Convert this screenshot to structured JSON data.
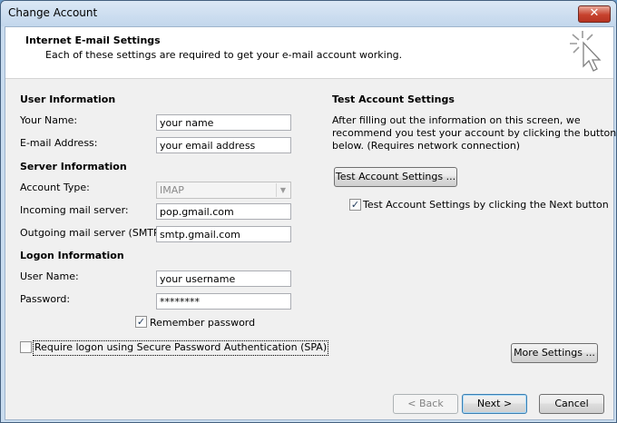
{
  "window": {
    "title": "Change Account",
    "close_symbol": "✕"
  },
  "header": {
    "title": "Internet E-mail Settings",
    "subtitle": "Each of these settings are required to get your e-mail account working."
  },
  "user_info": {
    "section": "User Information",
    "name_label": "Your Name:",
    "name_value": "your name",
    "email_label": "E-mail Address:",
    "email_value": "your email address"
  },
  "server_info": {
    "section": "Server Information",
    "account_type_label": "Account Type:",
    "account_type_value": "IMAP",
    "incoming_label": "Incoming mail server:",
    "incoming_value": "pop.gmail.com",
    "outgoing_label": "Outgoing mail server (SMTP):",
    "outgoing_value": "smtp.gmail.com"
  },
  "logon_info": {
    "section": "Logon Information",
    "username_label": "User Name:",
    "username_value": "your username",
    "password_label": "Password:",
    "password_value": "********",
    "remember_label": "Remember password",
    "remember_checked": true,
    "spa_label": "Require logon using Secure Password Authentication (SPA)",
    "spa_checked": false
  },
  "test_settings": {
    "section": "Test Account Settings",
    "description_lines": [
      "After filling out the information on this screen, we",
      "recommend you test your account by clicking the button",
      "below. (Requires network connection)"
    ],
    "button_label": "Test Account Settings ...",
    "next_checkbox_label": "Test Account Settings by clicking the Next button",
    "next_checkbox_checked": true
  },
  "buttons": {
    "more_settings": "More Settings ...",
    "back": "< Back",
    "next": "Next >",
    "cancel": "Cancel"
  },
  "colors": {
    "accent": "#3c7fb1",
    "close": "#c7422e"
  }
}
